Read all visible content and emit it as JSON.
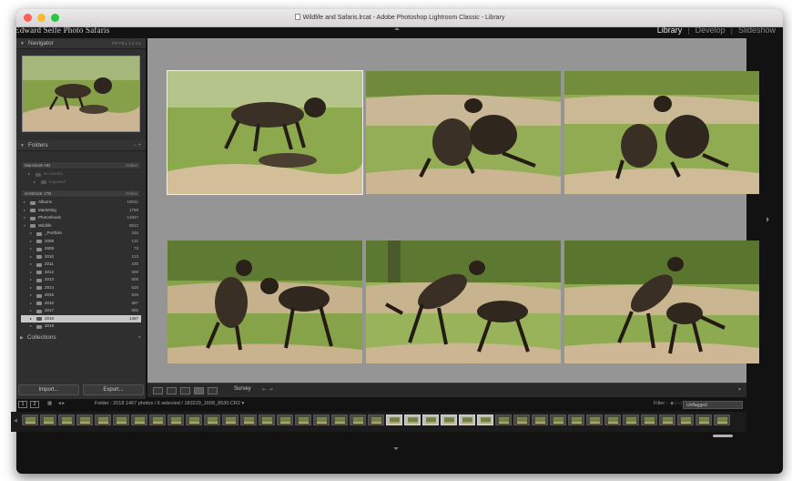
{
  "window": {
    "title": "Wildlife and Safaris.lrcat - Adobe Photoshop Lightroom Classic - Library"
  },
  "identity_plate": "Edward Selfe Photo Safaris",
  "modules": {
    "library": "Library",
    "develop": "Develop",
    "slideshow": "Slideshow",
    "separator": "|"
  },
  "navigator": {
    "title": "Navigator",
    "zoom_options": "FIT    FILL    1:1    1:1"
  },
  "folders": {
    "title": "Folders",
    "header_icons": "−  +",
    "volumes": [
      {
        "name": "Macintosh HD",
        "status": "Online"
      },
      {
        "name": "SANDISK 1TB",
        "status": "Online"
      }
    ],
    "mac_items": [
      {
        "name": "No Events",
        "count": ""
      },
      {
        "name": "Imported",
        "count": ""
      }
    ],
    "items": [
      {
        "name": "Albums",
        "count": "16041",
        "indent": 0
      },
      {
        "name": "Marketing",
        "count": "1759",
        "indent": 0
      },
      {
        "name": "Photoshoots",
        "count": "14847",
        "indent": 0
      },
      {
        "name": "Wildlife",
        "count": "5812",
        "indent": 0
      },
      {
        "name": "_Portfolio",
        "count": "246",
        "indent": 1
      },
      {
        "name": "2008",
        "count": "131",
        "indent": 1
      },
      {
        "name": "2009",
        "count": "73",
        "indent": 1
      },
      {
        "name": "2010",
        "count": "123",
        "indent": 1
      },
      {
        "name": "2011",
        "count": "235",
        "indent": 1
      },
      {
        "name": "2012",
        "count": "500",
        "indent": 1
      },
      {
        "name": "2013",
        "count": "509",
        "indent": 1
      },
      {
        "name": "2014",
        "count": "625",
        "indent": 1
      },
      {
        "name": "2015",
        "count": "525",
        "indent": 1
      },
      {
        "name": "2016",
        "count": "687",
        "indent": 1
      },
      {
        "name": "2017",
        "count": "855",
        "indent": 1
      },
      {
        "name": "2018",
        "count": "1467",
        "indent": 1
      },
      {
        "name": "2019",
        "count": "",
        "indent": 1
      }
    ]
  },
  "collections": {
    "title": "Collections",
    "add": "+"
  },
  "buttons": {
    "import": "Import...",
    "export": "Export..."
  },
  "toolbar": {
    "sort_label": "Survey"
  },
  "filmstrip_bar": {
    "pages": [
      "1",
      "2"
    ],
    "path_text": "Folder : 2018      1467 photos / 6 selected / 183229_1658_8530.CR2 ▾",
    "filter_label": "Filter :",
    "filter_value": "Unflagged"
  },
  "colors": {
    "accent": "#e6e6e6",
    "grid_bg": "#959595",
    "panel_bg": "#2f2f2f",
    "selected_row": "#c8c8c8"
  }
}
